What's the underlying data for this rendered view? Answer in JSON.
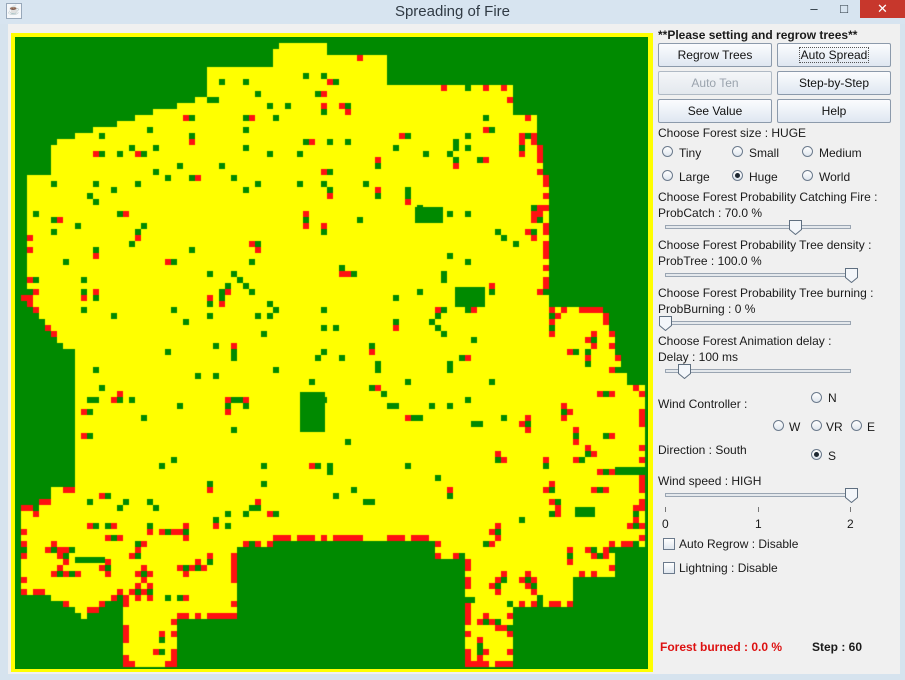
{
  "window": {
    "title": "Spreading of Fire",
    "app_icon": "java-cup-icon",
    "minimize": "–",
    "maximize": "□",
    "close": "✕"
  },
  "colors": {
    "border": "#ffff00",
    "tree": "#008a00",
    "burnt": "#ffff00",
    "burning": "#ff1111",
    "error_text": "#dd1111"
  },
  "panel": {
    "header": "**Please setting and regrow trees**",
    "buttons": {
      "regrow": "Regrow Trees",
      "auto_spread": "Auto Spread",
      "auto_ten": "Auto Ten",
      "step": "Step-by-Step",
      "see_value": "See Value",
      "help": "Help"
    },
    "forest_size": {
      "label": "Choose Forest size : HUGE",
      "options": [
        "Tiny",
        "Small",
        "Medium",
        "Large",
        "Huge",
        "World"
      ],
      "selected": "Huge"
    },
    "prob_catch": {
      "label": "Choose Forest Probability Catching Fire :",
      "value_label": "ProbCatch : 70.0 %",
      "value": 70
    },
    "prob_tree": {
      "label": "Choose Forest Probability Tree density :",
      "value_label": "ProbTree : 100.0 %",
      "value": 100
    },
    "prob_burning": {
      "label": "Choose Forest Probability Tree burning :",
      "value_label": "ProbBurning : 0 %",
      "value": 0
    },
    "delay": {
      "label": "Choose Forest Animation delay :",
      "value_label": "Delay : 100 ms",
      "value": 100
    },
    "wind": {
      "label": "Wind Controller :",
      "n": "N",
      "w": "W",
      "vr": "VR",
      "e": "E",
      "s": "S",
      "selected": "S",
      "direction_label": "Direction : South",
      "speed_label": "Wind speed : HIGH",
      "speed_value": 2,
      "ticks": [
        "0",
        "1",
        "2"
      ]
    },
    "auto_regrow": "Auto Regrow : Disable",
    "lightning": "Lightning : Disable",
    "forest_burned": "Forest burned : 0.0 %",
    "step": "Step : 60"
  }
}
